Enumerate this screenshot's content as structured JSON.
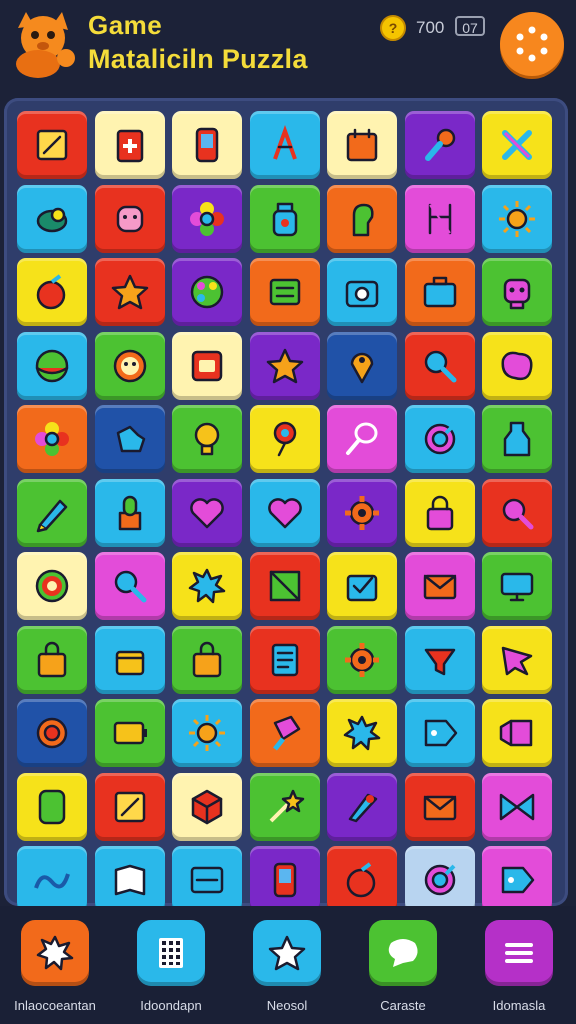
{
  "header": {
    "title_line1": "Game",
    "title_line2": "Mataliciln Puzzla",
    "coin_symbol": "?",
    "score": "700",
    "level_badge": "07",
    "menu_button": "menu"
  },
  "board": {
    "rows": [
      [
        {
          "color": "#e8321f",
          "icon": "note-icon"
        },
        {
          "color": "#fff3b0",
          "icon": "first-aid-icon"
        },
        {
          "color": "#fff3b0",
          "icon": "phone-icon"
        },
        {
          "color": "#2ab8ea",
          "icon": "compass-icon"
        },
        {
          "color": "#fff3b0",
          "icon": "calendar-icon"
        },
        {
          "color": "#7a28c8",
          "icon": "microphone-icon"
        },
        {
          "color": "#f6e21a",
          "icon": "cross-icon"
        }
      ],
      [
        {
          "color": "#2ab8ea",
          "icon": "fish-icon"
        },
        {
          "color": "#e8321f",
          "icon": "face-icon"
        },
        {
          "color": "#7a28c8",
          "icon": "flower-icon"
        },
        {
          "color": "#4cc232",
          "icon": "jar-icon"
        },
        {
          "color": "#f26a1b",
          "icon": "head-icon"
        },
        {
          "color": "#e34cd9",
          "icon": "chair-icon"
        },
        {
          "color": "#2ab8ea",
          "icon": "sun-icon"
        }
      ],
      [
        {
          "color": "#f6e21a",
          "icon": "apple-icon"
        },
        {
          "color": "#e8321f",
          "icon": "star-icon"
        },
        {
          "color": "#7a28c8",
          "icon": "palette-icon"
        },
        {
          "color": "#f26a1b",
          "icon": "list-icon"
        },
        {
          "color": "#2ab8ea",
          "icon": "camera-icon"
        },
        {
          "color": "#f26a1b",
          "icon": "briefcase-icon"
        },
        {
          "color": "#4cc232",
          "icon": "robot-icon"
        }
      ],
      [
        {
          "color": "#2ab8ea",
          "icon": "ball-icon"
        },
        {
          "color": "#4cc232",
          "icon": "gear-face-icon"
        },
        {
          "color": "#fff3b0",
          "icon": "stamp-icon"
        },
        {
          "color": "#7a28c8",
          "icon": "star-icon"
        },
        {
          "color": "#2052a8",
          "icon": "pin-icon"
        },
        {
          "color": "#e8321f",
          "icon": "magnifier-icon"
        },
        {
          "color": "#f6e21a",
          "icon": "blob-icon"
        }
      ],
      [
        {
          "color": "#f26a1b",
          "icon": "flower-icon"
        },
        {
          "color": "#2052a8",
          "icon": "hand-icon"
        },
        {
          "color": "#4cc232",
          "icon": "bulb-icon"
        },
        {
          "color": "#f6e21a",
          "icon": "lollipop-icon"
        },
        {
          "color": "#e34cd9",
          "icon": "racket-icon"
        },
        {
          "color": "#2ab8ea",
          "icon": "target-icon"
        },
        {
          "color": "#4cc232",
          "icon": "bottle-icon"
        }
      ],
      [
        {
          "color": "#4cc232",
          "icon": "pencil-icon"
        },
        {
          "color": "#2ab8ea",
          "icon": "cactus-icon"
        },
        {
          "color": "#7a28c8",
          "icon": "heart-icon"
        },
        {
          "color": "#2ab8ea",
          "icon": "heart-icon"
        },
        {
          "color": "#7a28c8",
          "icon": "gear-icon"
        },
        {
          "color": "#f6e21a",
          "icon": "lock-icon"
        },
        {
          "color": "#e8321f",
          "icon": "search-icon"
        }
      ],
      [
        {
          "color": "#fff3b0",
          "icon": "donut-icon"
        },
        {
          "color": "#e34cd9",
          "icon": "magnifier-icon"
        },
        {
          "color": "#f6e21a",
          "icon": "splash-icon"
        },
        {
          "color": "#e8321f",
          "icon": "frame-icon"
        },
        {
          "color": "#f6e21a",
          "icon": "checkbox-icon"
        },
        {
          "color": "#e34cd9",
          "icon": "envelope-icon"
        },
        {
          "color": "#4cc232",
          "icon": "monitor-icon"
        }
      ],
      [
        {
          "color": "#4cc232",
          "icon": "bag-icon"
        },
        {
          "color": "#2ab8ea",
          "icon": "box-icon"
        },
        {
          "color": "#4cc232",
          "icon": "bag-icon"
        },
        {
          "color": "#e8321f",
          "icon": "document-icon"
        },
        {
          "color": "#4cc232",
          "icon": "gear-icon"
        },
        {
          "color": "#2ab8ea",
          "icon": "funnel-icon"
        },
        {
          "color": "#f6e21a",
          "icon": "arrow-icon"
        }
      ],
      [
        {
          "color": "#2052a8",
          "icon": "speaker-icon"
        },
        {
          "color": "#4cc232",
          "icon": "battery-icon"
        },
        {
          "color": "#2ab8ea",
          "icon": "sun-icon"
        },
        {
          "color": "#f26a1b",
          "icon": "paint-icon"
        },
        {
          "color": "#f6e21a",
          "icon": "splash-icon"
        },
        {
          "color": "#2ab8ea",
          "icon": "tag-icon"
        },
        {
          "color": "#f6e21a",
          "icon": "banner-icon"
        }
      ],
      [
        {
          "color": "#f6e21a",
          "icon": "card-icon"
        },
        {
          "color": "#e8321f",
          "icon": "note-icon"
        },
        {
          "color": "#fff3b0",
          "icon": "cube-icon"
        },
        {
          "color": "#4cc232",
          "icon": "wand-icon"
        },
        {
          "color": "#7a28c8",
          "icon": "rocket-icon"
        },
        {
          "color": "#e8321f",
          "icon": "envelope-icon"
        },
        {
          "color": "#e34cd9",
          "icon": "bowtie-icon"
        }
      ],
      [
        {
          "color": "#2ab8ea",
          "icon": "wave-icon"
        },
        {
          "color": "#2ab8ea",
          "icon": "book-icon"
        },
        {
          "color": "#2ab8ea",
          "icon": "tv-icon"
        },
        {
          "color": "#7a28c8",
          "icon": "phone-icon"
        },
        {
          "color": "#e8321f",
          "icon": "apple-icon"
        },
        {
          "color": "#b8d4f0",
          "icon": "target-icon"
        },
        {
          "color": "#e34cd9",
          "icon": "tag-icon"
        }
      ]
    ]
  },
  "nav": {
    "items": [
      {
        "label": "Inlaocoeantan",
        "color": "#f26a1b",
        "icon": "splash-icon"
      },
      {
        "label": "Idoondapn",
        "color": "#2ab8ea",
        "icon": "grid-icon"
      },
      {
        "label": "Neosol",
        "color": "#2ab8ea",
        "icon": "star-icon"
      },
      {
        "label": "Caraste",
        "color": "#4cc232",
        "icon": "chat-icon"
      },
      {
        "label": "Idomasla",
        "color": "#b530c8",
        "icon": "menu-icon"
      }
    ]
  }
}
